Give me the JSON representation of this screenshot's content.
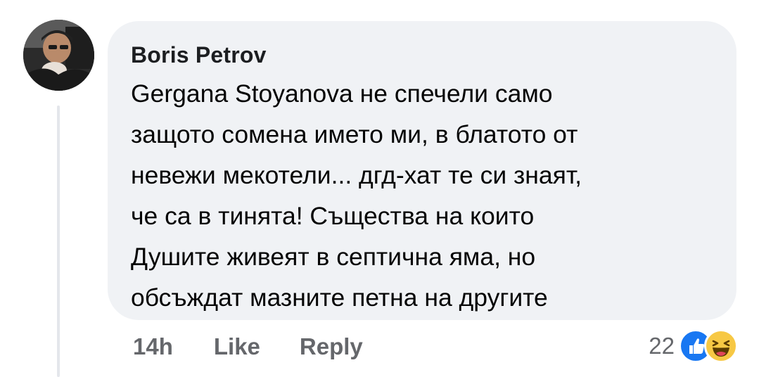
{
  "comment": {
    "author": "Boris Petrov",
    "text_lines": [
      "Gergana Stoyanova не спечели само",
      "защото сомена името ми, в блатото от",
      "невежи мекотели... дгд-хат те си знаят,",
      "че са в тинята! Същества на които",
      "Душите живеят в септична яма, но",
      "обсъждат мазните петна на другите"
    ],
    "time": "14h",
    "like_label": "Like",
    "reply_label": "Reply",
    "reaction_count": "22",
    "reaction_icons": [
      "like-reaction-icon",
      "haha-reaction-icon"
    ]
  },
  "colors": {
    "bubble": "#f0f2f5",
    "meta_text": "#65676b",
    "like_blue": "#1877f2",
    "haha_yellow": "#f7c844"
  }
}
